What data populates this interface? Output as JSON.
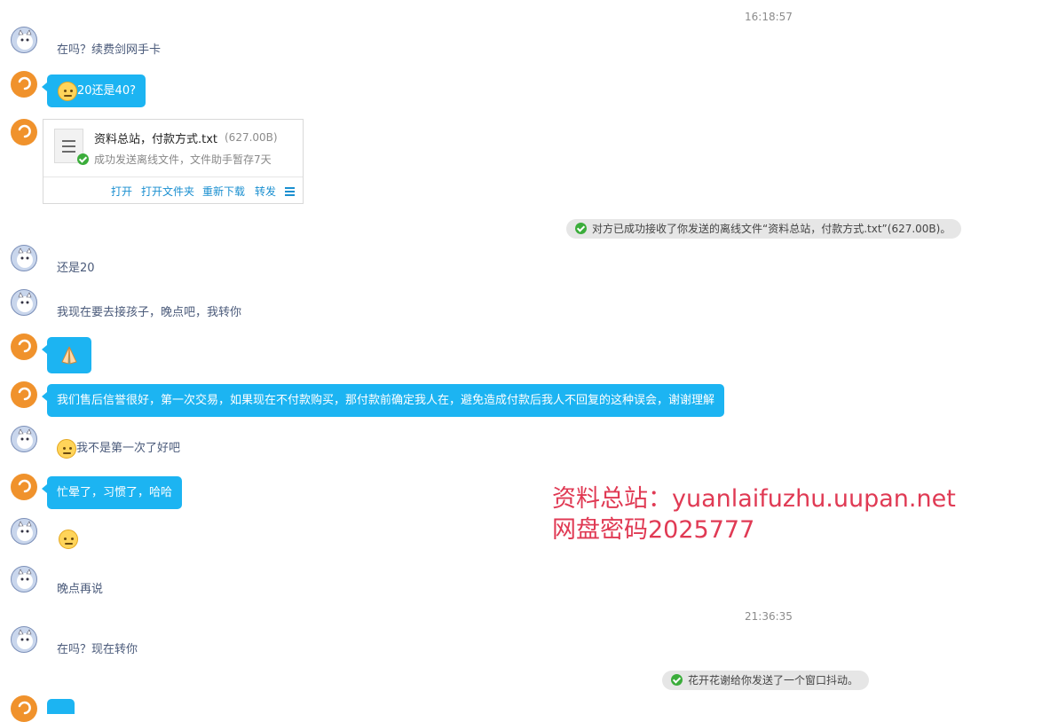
{
  "timestamps": [
    "16:18:57",
    "21:36:35"
  ],
  "messages": {
    "m1": "在吗？续费剑网手卡",
    "m2": "20还是40?",
    "m4": "还是20",
    "m5": "我现在要去接孩子，晚点吧，我转你",
    "m7": "我们售后信誉很好，第一次交易，如果现在不付款购买，那付款前确定我人在，避免造成付款后我人不回复的这种误会，谢谢理解",
    "m8": "我不是第一次了好吧",
    "m9": "忙晕了，习惯了，哈哈",
    "m11": "晚点再说",
    "m12": "在吗？现在转你"
  },
  "file_card": {
    "filename": "资料总站，付款方式.txt",
    "size": "(627.00B)",
    "status": "成功发送离线文件，文件助手暂存7天",
    "actions": [
      "打开",
      "打开文件夹",
      "重新下载",
      "转发"
    ]
  },
  "system_notes": {
    "file_received": "对方已成功接收了你发送的离线文件“资料总站，付款方式.txt”(627.00B)。",
    "shake": "花开花谢给你发送了一个窗口抖动。"
  },
  "watermark": {
    "line1": "资料总站：yuanlaifuzhu.uupan.net",
    "line2": "网盘密码2025777"
  },
  "colors": {
    "bubble": "#1cb4f2",
    "watermark": "#e03a54",
    "link": "#1a8fd0"
  }
}
